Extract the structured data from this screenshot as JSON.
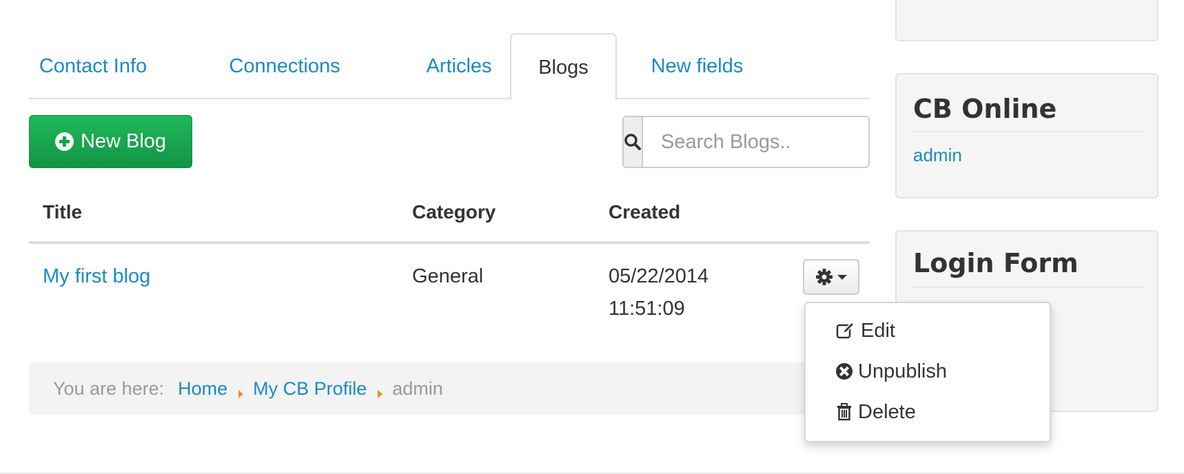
{
  "tabs": [
    {
      "label": "Contact Info"
    },
    {
      "label": "Connections"
    },
    {
      "label": "Articles"
    },
    {
      "label": "Blogs",
      "active": true
    },
    {
      "label": "New fields"
    }
  ],
  "toolbar": {
    "new_blog_label": "New Blog",
    "search_placeholder": "Search Blogs.."
  },
  "table": {
    "columns": [
      "Title",
      "Category",
      "Created"
    ],
    "rows": [
      {
        "title": "My first blog",
        "category": "General",
        "created_date": "05/22/2014",
        "created_time": "11:51:09"
      }
    ]
  },
  "row_menu": {
    "items": [
      {
        "label": "Edit",
        "icon": "edit-icon"
      },
      {
        "label": "Unpublish",
        "icon": "unpublish-icon"
      },
      {
        "label": "Delete",
        "icon": "trash-icon"
      }
    ]
  },
  "breadcrumb": {
    "prefix": "You are here:",
    "links": [
      "Home",
      "My CB Profile"
    ],
    "current": "admin"
  },
  "sidebar": {
    "cb_online": {
      "title": "CB Online",
      "users": [
        "admin"
      ]
    },
    "login_form": {
      "title": "Login Form"
    }
  },
  "colors": {
    "link": "#1a8ac6",
    "success": "#16a34f",
    "breadcrumb_separator": "#f0901e"
  }
}
